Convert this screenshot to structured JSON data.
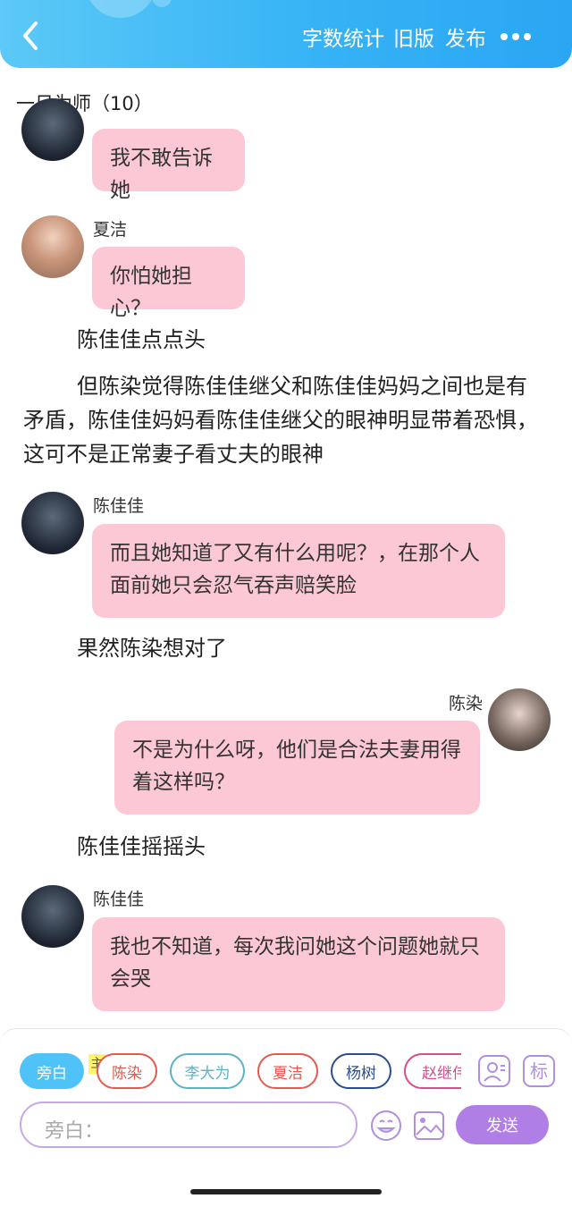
{
  "header": {
    "links": [
      "字数统计",
      "旧版",
      "发布"
    ]
  },
  "subtitle": "一日为师（10）",
  "messages": [
    {
      "name": "",
      "text": "我不敢告诉她"
    },
    {
      "name": "夏洁",
      "text": "你怕她担心？"
    },
    {
      "name": "陈佳佳",
      "text": "而且她知道了又有什么用呢？，在那个人面前她只会忍气吞声赔笑脸"
    },
    {
      "name": "陈染",
      "text": "不是为什么呀，他们是合法夫妻用得着这样吗？"
    },
    {
      "name": "陈佳佳",
      "text": "我也不知道，每次我问她这个问题她就只会哭"
    }
  ],
  "narrations": [
    "陈佳佳点点头",
    "但陈染觉得陈佳佳继父和陈佳佳妈妈之间也是有矛盾，陈佳佳妈妈看陈佳佳继父的眼神明显带着恐惧，这可不是正常妻子看丈夫的眼神",
    "果然陈染想对了",
    "陈佳佳摇摇头"
  ],
  "roles": [
    "旁白",
    "陈染",
    "李大为",
    "夏洁",
    "杨树",
    "赵继伟"
  ],
  "host_badge": "主",
  "tool_label": "标",
  "input": {
    "placeholder": "旁白："
  },
  "send_label": "发送",
  "colors": {
    "header": "#36b3f5",
    "bubble": "#fcc8d6",
    "active_role": "#4fc3f7",
    "send": "#b07fe6",
    "role_chen_ran": "#e35a4f",
    "role_li_dawei": "#5bb3c4",
    "role_xia_jie": "#e35a4f",
    "role_yang_shu": "#2a4d8f",
    "role_zhao_jiwei": "#d94b8c"
  },
  "icons": [
    "back-arrow-icon",
    "more-dots-icon",
    "character-icon",
    "emoji-icon",
    "image-icon"
  ]
}
